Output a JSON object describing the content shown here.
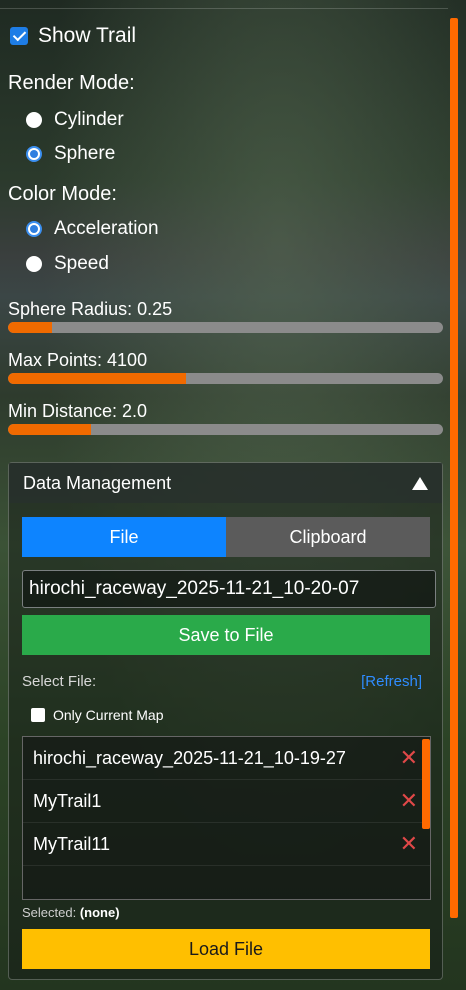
{
  "show_trail": {
    "label": "Show Trail",
    "checked": true
  },
  "render_mode": {
    "label": "Render Mode:",
    "options": [
      "Cylinder",
      "Sphere"
    ],
    "selected": "Sphere"
  },
  "color_mode": {
    "label": "Color Mode:",
    "options": [
      "Acceleration",
      "Speed"
    ],
    "selected": "Acceleration"
  },
  "sliders": [
    {
      "label": "Sphere Radius: 0.25",
      "fill_fraction": 0.1
    },
    {
      "label": "Max Points: 4100",
      "fill_fraction": 0.41
    },
    {
      "label": "Min Distance: 2.0",
      "fill_fraction": 0.19
    }
  ],
  "data_management": {
    "title": "Data Management",
    "tabs": [
      "File",
      "Clipboard"
    ],
    "active_tab": "File",
    "filename_value": "hirochi_raceway_2025-11-21_10-20-07",
    "save_label": "Save to File",
    "select_file_label": "Select File:",
    "refresh_label": "[Refresh]",
    "only_current_map_label": "Only Current Map",
    "files": [
      "hirochi_raceway_2025-11-21_10-19-27",
      "MyTrail1",
      "MyTrail11"
    ],
    "delete_glyph": "✕",
    "selected_label": "Selected:",
    "selected_value": "(none)",
    "load_label": "Load File"
  },
  "colors": {
    "accent_orange": "#ff6a00",
    "tab_active": "#0d84ff",
    "save_green": "#2aaa4a",
    "load_yellow": "#ffbf00",
    "delete_red": "#e04848"
  }
}
